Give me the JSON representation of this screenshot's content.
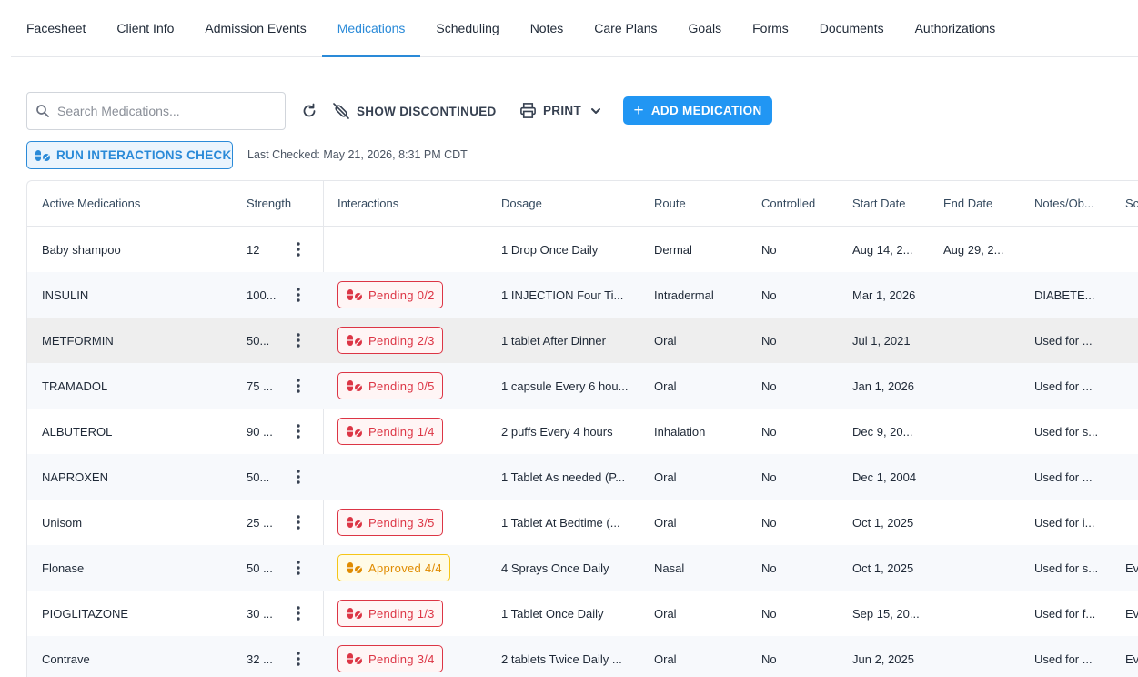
{
  "tabs": [
    "Facesheet",
    "Client Info",
    "Admission Events",
    "Medications",
    "Scheduling",
    "Notes",
    "Care Plans",
    "Goals",
    "Forms",
    "Documents",
    "Authorizations"
  ],
  "active_tab": "Medications",
  "toolbar": {
    "search_placeholder": "Search Medications...",
    "show_discontinued": "SHOW DISCONTINUED",
    "print": "PRINT",
    "add_medication": "ADD MEDICATION",
    "run_interactions": "RUN INTERACTIONS CHECK",
    "last_checked": "Last Checked: May 21, 2026, 8:31 PM CDT"
  },
  "table": {
    "headers": [
      "Active Medications",
      "Strength",
      "Interactions",
      "Dosage",
      "Route",
      "Controlled",
      "Start Date",
      "End Date",
      "Notes/Ob...",
      "Sc"
    ],
    "rows": [
      {
        "name": "Baby shampoo",
        "strength": "12",
        "interaction": "",
        "status": "",
        "dosage": "1 Drop Once Daily",
        "route": "Dermal",
        "controlled": "No",
        "start": "Aug 14, 2...",
        "end": "Aug 29, 2...",
        "notes": "",
        "sc": ""
      },
      {
        "name": "INSULIN",
        "strength": "100...",
        "interaction": "Pending 0/2",
        "status": "pending",
        "dosage": "1 INJECTION Four Ti...",
        "route": "Intradermal",
        "controlled": "No",
        "start": "Mar 1, 2026",
        "end": "",
        "notes": "DIABETE...",
        "sc": ""
      },
      {
        "name": "METFORMIN",
        "strength": "50...",
        "interaction": "Pending 2/3",
        "status": "pending",
        "dosage": "1 tablet After Dinner",
        "route": "Oral",
        "controlled": "No",
        "start": "Jul 1, 2021",
        "end": "",
        "notes": "Used for ...",
        "sc": ""
      },
      {
        "name": "TRAMADOL",
        "strength": "75 ...",
        "interaction": "Pending 0/5",
        "status": "pending",
        "dosage": "1 capsule Every 6 hou...",
        "route": "Oral",
        "controlled": "No",
        "start": "Jan 1, 2026",
        "end": "",
        "notes": "Used for ...",
        "sc": ""
      },
      {
        "name": "ALBUTEROL",
        "strength": "90 ...",
        "interaction": "Pending 1/4",
        "status": "pending",
        "dosage": "2 puffs Every 4 hours",
        "route": "Inhalation",
        "controlled": "No",
        "start": "Dec 9, 20...",
        "end": "",
        "notes": "Used for s...",
        "sc": ""
      },
      {
        "name": "NAPROXEN",
        "strength": "50...",
        "interaction": "",
        "status": "",
        "dosage": "1 Tablet As needed (P...",
        "route": "Oral",
        "controlled": "No",
        "start": "Dec 1, 2004",
        "end": "",
        "notes": "Used for ...",
        "sc": ""
      },
      {
        "name": "Unisom",
        "strength": "25 ...",
        "interaction": "Pending 3/5",
        "status": "pending",
        "dosage": "1 Tablet At Bedtime (...",
        "route": "Oral",
        "controlled": "No",
        "start": "Oct 1, 2025",
        "end": "",
        "notes": "Used for i...",
        "sc": ""
      },
      {
        "name": "Flonase",
        "strength": "50 ...",
        "interaction": "Approved 4/4",
        "status": "approved",
        "dosage": "4 Sprays Once Daily",
        "route": "Nasal",
        "controlled": "No",
        "start": "Oct 1, 2025",
        "end": "",
        "notes": "Used for s...",
        "sc": "Ev"
      },
      {
        "name": "PIOGLITAZONE",
        "strength": "30 ...",
        "interaction": "Pending 1/3",
        "status": "pending",
        "dosage": "1 Tablet Once Daily",
        "route": "Oral",
        "controlled": "No",
        "start": "Sep 15, 20...",
        "end": "",
        "notes": "Used for f...",
        "sc": "Ev"
      },
      {
        "name": "Contrave",
        "strength": "32 ...",
        "interaction": "Pending 3/4",
        "status": "pending",
        "dosage": "2 tablets Twice Daily ...",
        "route": "Oral",
        "controlled": "No",
        "start": "Jun 2, 2025",
        "end": "",
        "notes": "Used for ...",
        "sc": "Ev"
      }
    ],
    "highlighted_row": 2
  },
  "colors": {
    "accent": "#2a8ad8",
    "add_button": "#2196f3",
    "pending": "#dc3545",
    "approved": "#e08b00"
  }
}
